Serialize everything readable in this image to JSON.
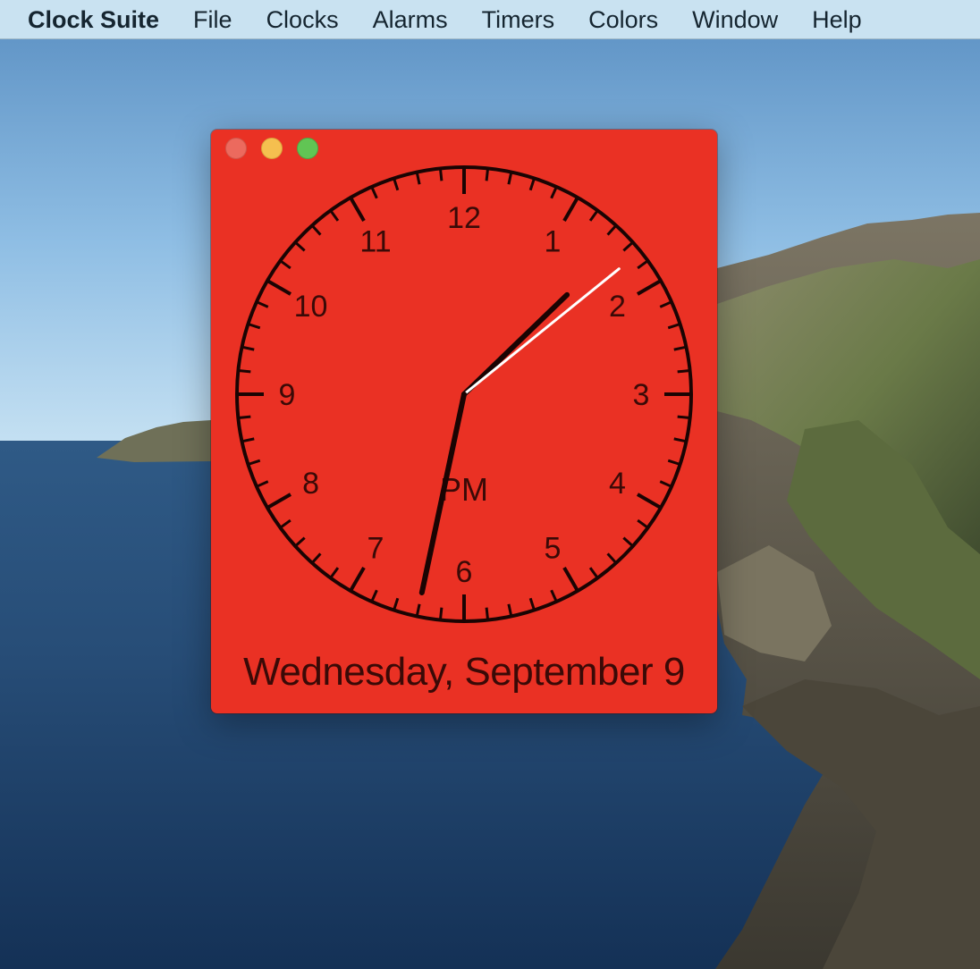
{
  "menubar": {
    "app_name": "Clock Suite",
    "items": [
      "File",
      "Clocks",
      "Alarms",
      "Timers",
      "Colors",
      "Window",
      "Help"
    ]
  },
  "window": {
    "background_color": "#ea3124",
    "buttons": {
      "close": "close-icon",
      "minimize": "minimize-icon",
      "zoom": "zoom-icon"
    }
  },
  "clock": {
    "numbers": [
      "12",
      "1",
      "2",
      "3",
      "4",
      "5",
      "6",
      "7",
      "8",
      "9",
      "10",
      "11"
    ],
    "period": "PM",
    "date": "Wednesday, September 9",
    "time": {
      "hour": 1,
      "minute": 32,
      "second": 8.5
    },
    "face_color": "#ea3124",
    "ink_color": "#1a0403",
    "second_hand_color": "#ffffff"
  }
}
